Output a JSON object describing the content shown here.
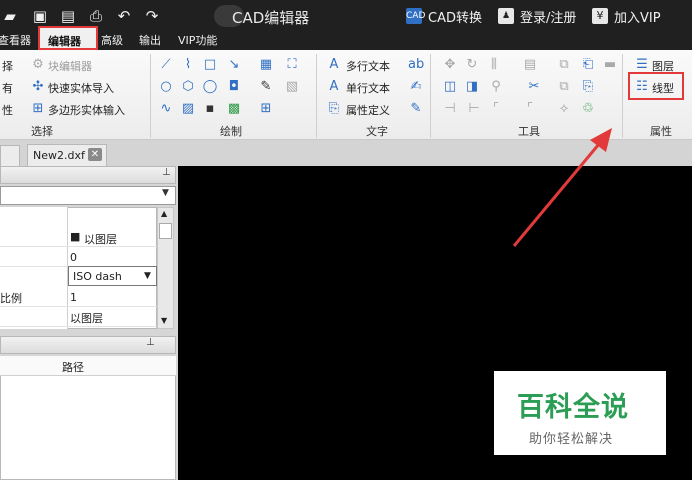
{
  "title_bar": {
    "app_title": "CAD编辑器",
    "cad_convert": "CAD转换",
    "login": "登录/注册",
    "vip": "加入VIP"
  },
  "menu": [
    "查看器",
    "编辑器",
    "高级",
    "输出",
    "VIP功能"
  ],
  "ribbon": {
    "select_group": {
      "label": "选择",
      "items": [
        "择",
        "有",
        "性"
      ],
      "block_editor": "块编辑器",
      "quick_import": "快速实体导入",
      "polygon_input": "多边形实体输入"
    },
    "draw_group": {
      "label": "绘制"
    },
    "text_group": {
      "label": "文字",
      "mtext": "多行文本",
      "stext": "单行文本",
      "attdef": "属性定义"
    },
    "tools_group": {
      "label": "工具"
    },
    "props_group": {
      "label": "属性",
      "layer": "图层",
      "linetype": "线型"
    }
  },
  "tabs": {
    "file_tab": "New2.dxf"
  },
  "properties": {
    "rows": [
      {
        "key": "",
        "value": "以图层"
      },
      {
        "key": "",
        "value": "0"
      },
      {
        "key": "",
        "value": "ISO dash"
      },
      {
        "key": "比例",
        "value": "1"
      },
      {
        "key": "",
        "value": "以图层"
      }
    ]
  },
  "path_panel": {
    "column_path": "路径"
  },
  "watermark": {
    "title": "百科全说",
    "subtitle": "助你轻松解决"
  },
  "colors": {
    "highlight": "#e23a3a",
    "canvas": "#000000",
    "watermark_green": "#2b9d54"
  },
  "icons": [
    "folder-icon",
    "save-icon",
    "save-as-icon",
    "print-icon",
    "undo-icon",
    "redo-icon",
    "cad-convert-icon",
    "user-icon",
    "yen-icon",
    "pin-icon",
    "close-icon"
  ]
}
